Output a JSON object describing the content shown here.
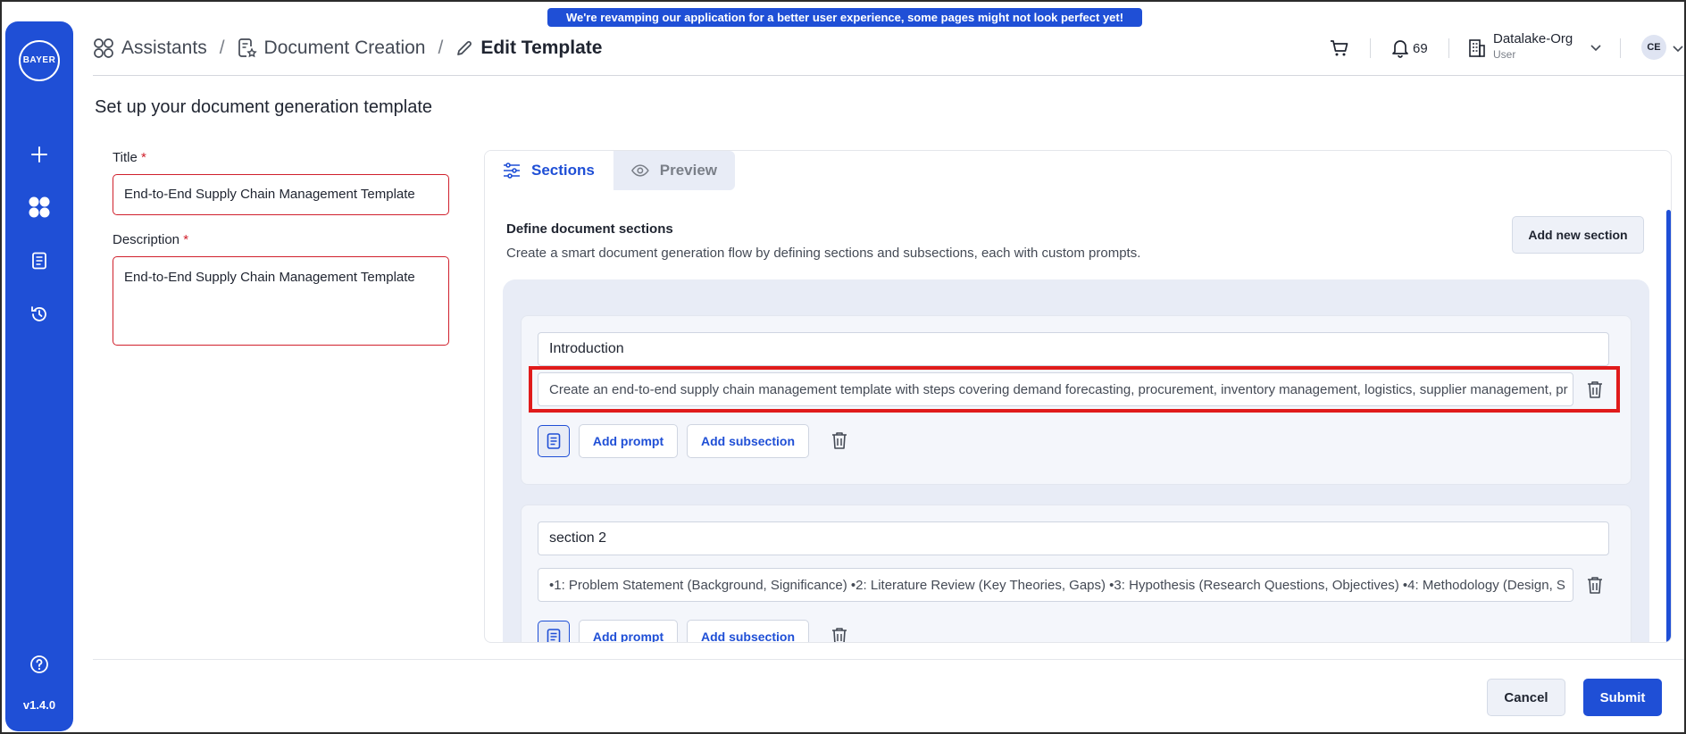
{
  "banner": "We're revamping our application for a better user experience, some pages might not look perfect yet!",
  "sidebar": {
    "logo_h": "BAYER",
    "logo_v": "BAYER",
    "version": "v1.4.0"
  },
  "breadcrumb": {
    "items": [
      "Assistants",
      "Document Creation",
      "Edit Template"
    ],
    "separator": "/"
  },
  "header": {
    "notifications_count": "69",
    "org_name": "Datalake-Org",
    "org_role": "User",
    "avatar_initials": "CE"
  },
  "page_title": "Set up your document generation template",
  "form": {
    "title_label": "Title",
    "title_value": "End-to-End Supply Chain Management Template",
    "description_label": "Description",
    "description_value": "End-to-End Supply Chain Management Template",
    "required_mark": "*"
  },
  "tabs": {
    "sections": "Sections",
    "preview": "Preview"
  },
  "sections_panel": {
    "title": "Define document sections",
    "description": "Create a smart document generation flow by defining sections and subsections, each with custom prompts.",
    "add_section_label": "Add new section",
    "add_prompt_label": "Add prompt",
    "add_subsection_label": "Add subsection"
  },
  "sections": [
    {
      "name": "Introduction",
      "prompt": "Create an end-to-end supply chain management template with steps covering demand forecasting, procurement, inventory management, logistics, supplier management, pr"
    },
    {
      "name": "section 2",
      "prompt": "•1: Problem Statement (Background, Significance) •2: Literature Review (Key Theories, Gaps) •3: Hypothesis (Research Questions, Objectives) •4: Methodology (Design, S"
    }
  ],
  "footer": {
    "cancel": "Cancel",
    "submit": "Submit"
  },
  "colors": {
    "accent": "#1f4fd6",
    "error": "#d0202c",
    "highlight": "#e01b1b"
  }
}
